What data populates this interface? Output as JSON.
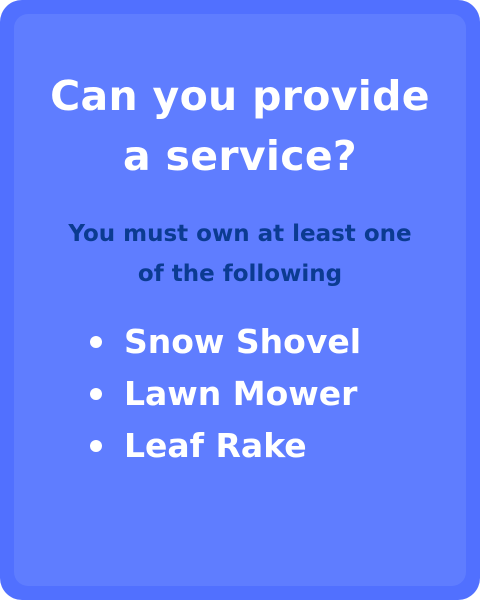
{
  "card": {
    "title_line1": "Can you provide",
    "title_line2": "a service?",
    "subtitle_line1": "You must own at least one",
    "subtitle_line2": "of the following",
    "items": [
      {
        "label": "Snow Shovel"
      },
      {
        "label": "Lawn Mower"
      },
      {
        "label": "Leaf Rake"
      }
    ]
  },
  "colors": {
    "card_border": "#5170ff",
    "card_background": "#5f7dff",
    "title_text": "#ffffff",
    "subtitle_text": "#0b3b91",
    "item_text": "#ffffff"
  }
}
